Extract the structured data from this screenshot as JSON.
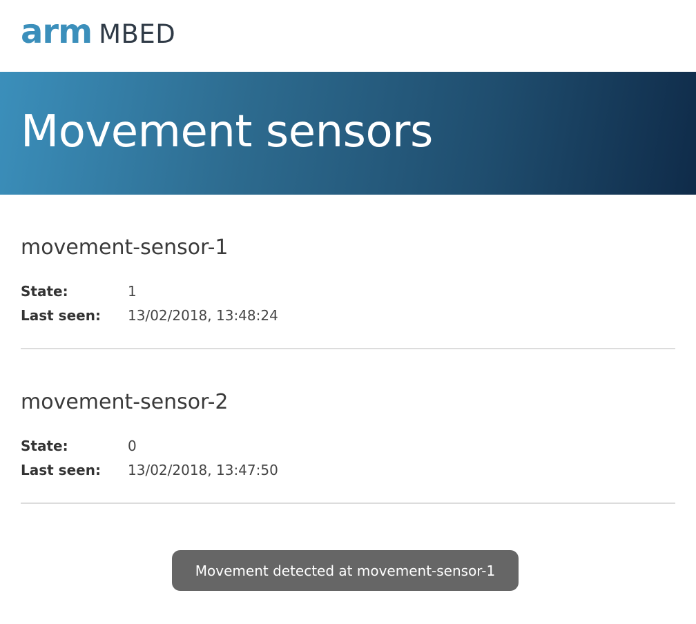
{
  "logo": {
    "arm_text": "arm",
    "mbed_text": "MBED",
    "arm_color": "#3b8fbb",
    "mbed_color": "#2f3a46"
  },
  "hero": {
    "title": "Movement sensors"
  },
  "labels": {
    "state": "State:",
    "last_seen": "Last seen:"
  },
  "sensors": [
    {
      "name": "movement-sensor-1",
      "state": "1",
      "last_seen": "13/02/2018, 13:48:24"
    },
    {
      "name": "movement-sensor-2",
      "state": "0",
      "last_seen": "13/02/2018, 13:47:50"
    }
  ],
  "toast": {
    "message": "Movement detected at movement-sensor-1"
  }
}
